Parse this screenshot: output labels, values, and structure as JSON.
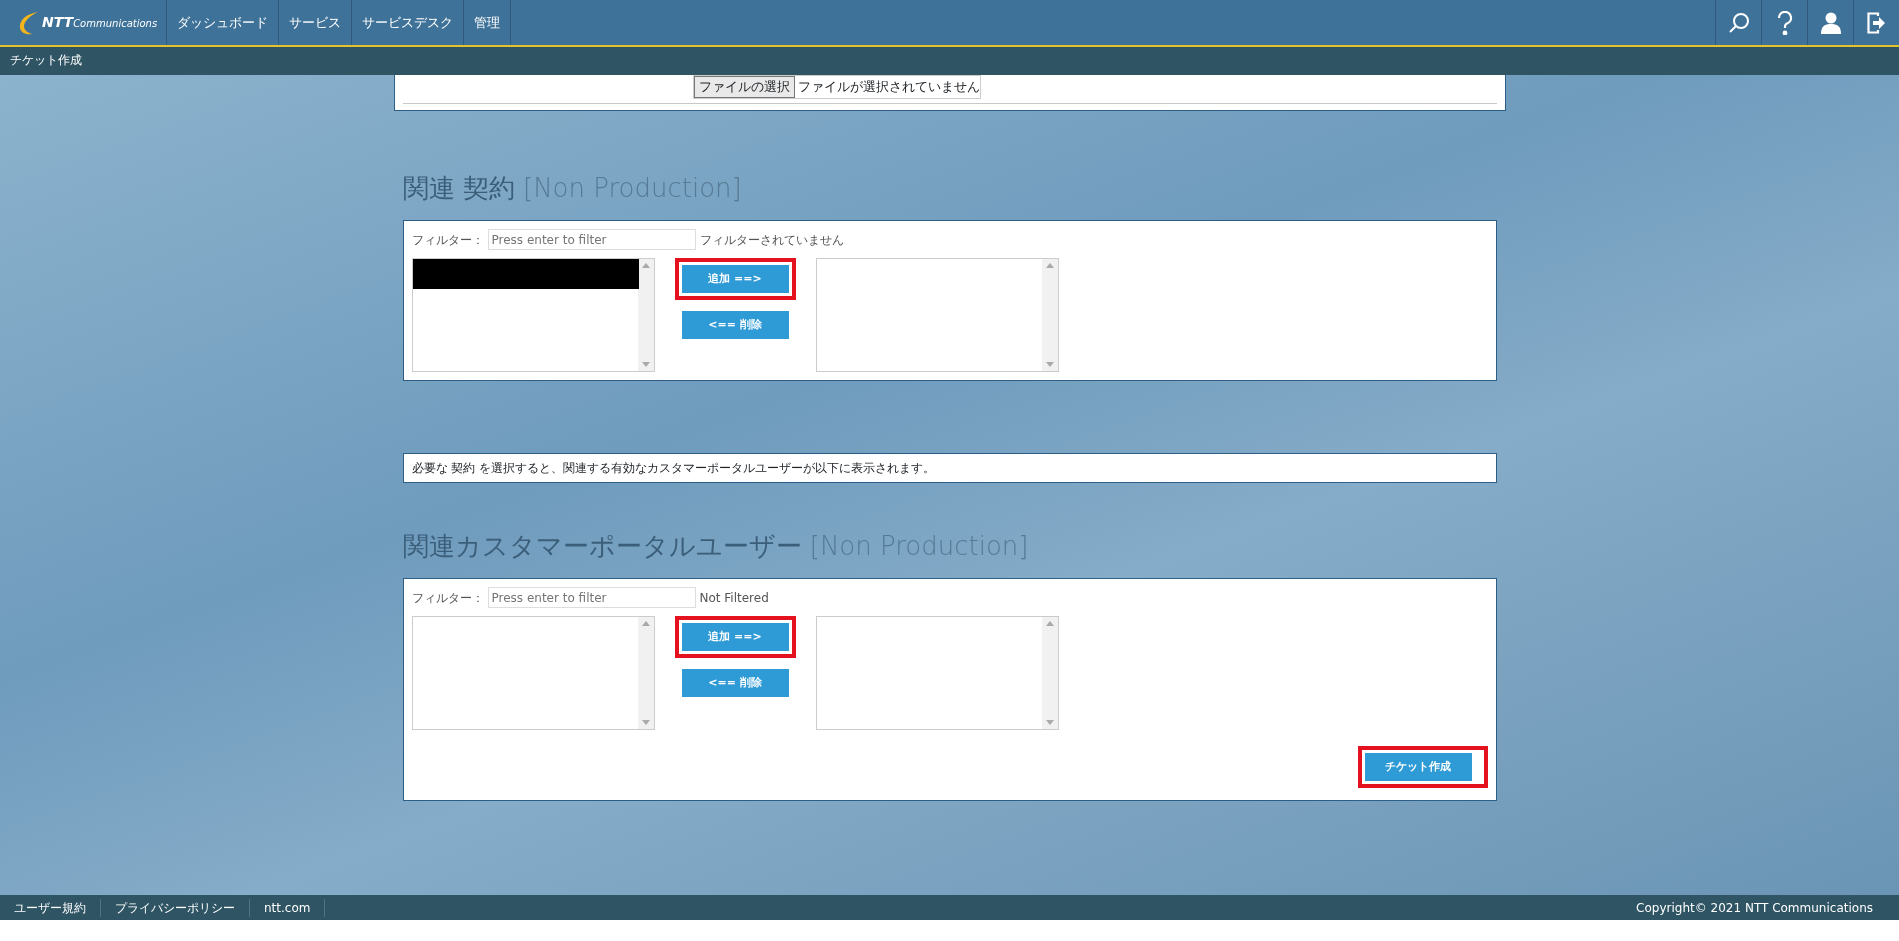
{
  "header": {
    "logo": {
      "brand": "NTT",
      "sub": "Communications"
    },
    "nav": [
      {
        "label": "ダッシュボード"
      },
      {
        "label": "サービス"
      },
      {
        "label": "サービスデスク"
      },
      {
        "label": "管理"
      }
    ],
    "icons": [
      {
        "kind": "search"
      },
      {
        "kind": "help"
      },
      {
        "kind": "user"
      },
      {
        "kind": "logout"
      }
    ]
  },
  "breadcrumb": "チケット作成",
  "attachment": {
    "button": "ファイルの選択",
    "status": "ファイルが選択されていません"
  },
  "sections": [
    {
      "kind": "picker",
      "title": "関連 契約",
      "tag": "[Non Production]",
      "filter_label": "フィルター：",
      "placeholder": "Press enter to filter",
      "filter_status": "フィルターされていません",
      "left_items": [
        {
          "kind": "redacted"
        }
      ],
      "add": {
        "label": "追加 ==>",
        "highlighted": true
      },
      "remove": {
        "label": "<== 削除"
      }
    },
    {
      "kind": "note",
      "text": "必要な 契約 を選択すると、関連する有効なカスタマーポータルユーザーが以下に表示されます。"
    },
    {
      "kind": "picker",
      "title": "関連カスタマーポータルユーザー",
      "tag": "[Non Production]",
      "filter_label": "フィルター：",
      "placeholder": "Press enter to filter",
      "filter_status": "Not Filtered",
      "add": {
        "label": "追加 ==>",
        "highlighted": true
      },
      "remove": {
        "label": "<== 削除"
      },
      "submit": {
        "label": "チケット作成",
        "highlighted": true
      }
    }
  ],
  "footer": {
    "links": [
      {
        "label": "ユーザー規約"
      },
      {
        "label": "プライバシーポリシー"
      },
      {
        "label": "ntt.com"
      }
    ],
    "copyright": "Copyright© 2021 NTT Communications"
  }
}
